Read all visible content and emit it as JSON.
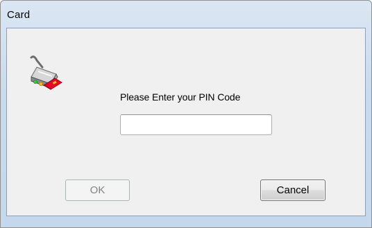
{
  "window": {
    "title": "Card"
  },
  "dialog": {
    "icon": "smart-card-reader-icon",
    "prompt": "Please Enter your PIN Code",
    "pin_value": "",
    "ok_label": "OK",
    "ok_enabled": false,
    "cancel_label": "Cancel"
  },
  "colors": {
    "frame": "#c9dbee",
    "client": "#f0f0f0",
    "card": "#e8002a",
    "led_green": "#2ecc40",
    "disabled_text": "#838383"
  }
}
